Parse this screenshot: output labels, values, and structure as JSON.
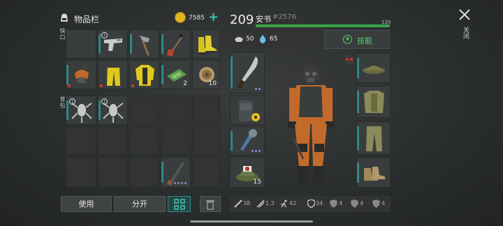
{
  "header": {
    "title": "物品栏",
    "coins": "7585",
    "plus": "+",
    "level": "209",
    "player_name": "安书",
    "player_id": "#2576",
    "health_max": "120",
    "health_fraction": 1.0
  },
  "sections": {
    "equipped_label": "快口",
    "backpack_label": "背包"
  },
  "quick_items": [
    {
      "name": "pistol",
      "qty": ""
    },
    {
      "name": "hatchet",
      "qty": ""
    },
    {
      "name": "shovel",
      "qty": ""
    },
    {
      "name": "boots",
      "qty": ""
    },
    {
      "name": "mask-helmet",
      "qty": ""
    },
    {
      "name": "yellow-pants",
      "qty": ""
    },
    {
      "name": "yellow-jacket",
      "qty": ""
    },
    {
      "name": "cash-bundle",
      "qty": "2"
    },
    {
      "name": "rope-coil",
      "qty": "10"
    }
  ],
  "backpack_items": [
    {
      "name": "creature-part-1",
      "qty": ""
    },
    {
      "name": "creature-part-2",
      "qty": ""
    },
    {
      "name": "rifle",
      "qty": ""
    }
  ],
  "stats": {
    "food": "50",
    "water": "65",
    "skills_label": "技能"
  },
  "actions": {
    "use_label": "使用",
    "split_label": "分开"
  },
  "gear_left": [
    {
      "name": "machete",
      "qty": ""
    },
    {
      "name": "backpack-radiation",
      "qty": ""
    },
    {
      "name": "spiked-club",
      "qty": ""
    },
    {
      "name": "medkit-hat",
      "qty": "15"
    }
  ],
  "gear_right": [
    {
      "name": "cap"
    },
    {
      "name": "vest"
    },
    {
      "name": "cargo-pants"
    },
    {
      "name": "boots"
    }
  ],
  "bottom_stats": [
    "38",
    "1.3",
    "42",
    "34",
    "4",
    "4",
    "4"
  ],
  "close_label": "关闭",
  "colors": {
    "accent": "#2e8a86",
    "health": "#3aa34a",
    "gold": "#e2b420"
  }
}
